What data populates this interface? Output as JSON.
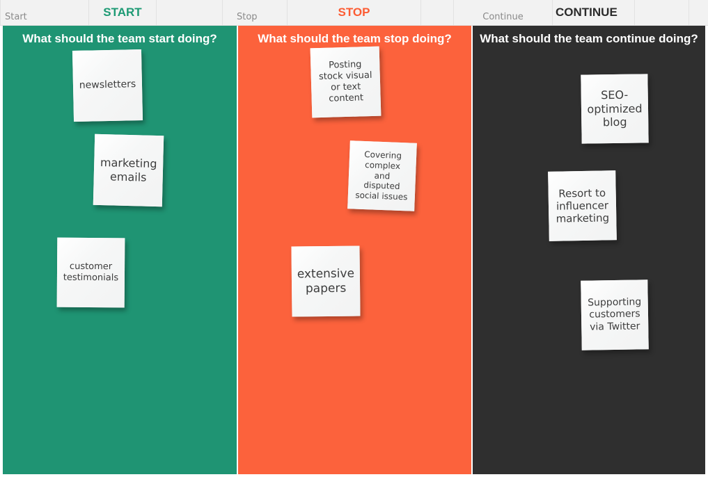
{
  "toolbar": {
    "cells": [
      {
        "label": "Start",
        "style": "small",
        "align": "left"
      },
      {
        "label": "START",
        "style": "big",
        "color": "#1d9a74"
      },
      {
        "label": "",
        "style": "small"
      },
      {
        "label": "Stop",
        "style": "small"
      },
      {
        "label": "STOP",
        "style": "big",
        "color": "#fc5c33"
      },
      {
        "label": "",
        "style": "small"
      },
      {
        "label": "Continue",
        "style": "small"
      },
      {
        "label": "CONTINUE",
        "style": "big",
        "color": "#2b2b2b"
      },
      {
        "label": "",
        "style": "small"
      },
      {
        "label": "",
        "style": "small"
      }
    ]
  },
  "board": {
    "columns": [
      {
        "id": "start",
        "header": "What should the team start doing?",
        "color": "#1f9473",
        "notes": [
          {
            "text": "newsletters",
            "font_size": 14
          },
          {
            "text": "marketing\nemails",
            "font_size": 16
          },
          {
            "text": "customer\ntestimonials",
            "font_size": 13
          }
        ]
      },
      {
        "id": "stop",
        "header": "What should the team stop doing?",
        "color": "#fc623c",
        "notes": [
          {
            "text": "Posting\nstock visual\nor text\ncontent",
            "font_size": 13
          },
          {
            "text": "Covering\ncomplex\nand\ndisputed\nsocial issues",
            "font_size": 12
          },
          {
            "text": "extensive\npapers",
            "font_size": 17
          }
        ]
      },
      {
        "id": "continue",
        "header": "What should the team continue doing?",
        "color": "#2f2f2f",
        "notes": [
          {
            "text": "SEO-\noptimized\nblog",
            "font_size": 16
          },
          {
            "text": "Resort to\ninfluencer\nmarketing",
            "font_size": 15
          },
          {
            "text": "Supporting\ncustomers\nvia Twitter",
            "font_size": 14
          }
        ]
      }
    ]
  }
}
